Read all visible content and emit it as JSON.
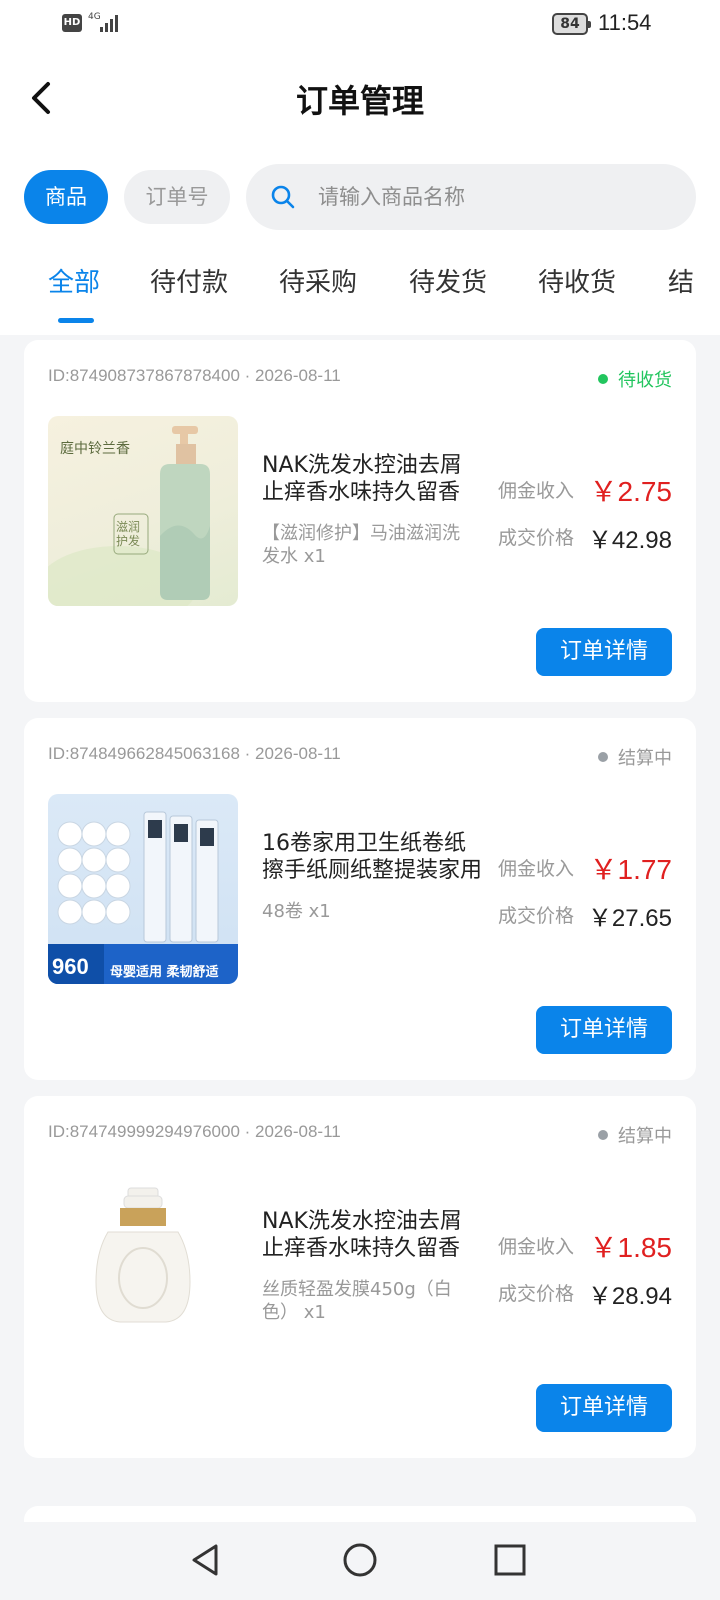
{
  "status_bar": {
    "hd": "HD",
    "network": "4G",
    "battery": "84",
    "time": "11:54"
  },
  "header": {
    "title": "订单管理"
  },
  "search": {
    "segment_product": "商品",
    "segment_order_no": "订单号",
    "placeholder": "请输入商品名称"
  },
  "tabs": [
    "全部",
    "待付款",
    "待采购",
    "待发货",
    "待收货",
    "结"
  ],
  "labels": {
    "commission": "佣金收入",
    "deal_price": "成交价格",
    "detail_button": "订单详情"
  },
  "colors": {
    "accent": "#0a84ea",
    "price_red": "#e02020",
    "status_green": "#22c55e",
    "status_grey": "#9aa0a6"
  },
  "orders": [
    {
      "id_date": "ID:874908737867878400 · 2026-08-11",
      "status": "待收货",
      "status_color": "#22c55e",
      "title": "NAK洗发水控油去屑止痒香水味持久留香",
      "sku": "【滋润修护】马油滋润洗发水 x1",
      "commission": "￥2.75",
      "deal_price": "￥42.98",
      "image_text": "庭中铃兰香",
      "image_sub": "滋润护发"
    },
    {
      "id_date": "ID:874849662845063168 · 2026-08-11",
      "status": "结算中",
      "status_color": "#9aa0a6",
      "title": "16卷家用卫生纸卷纸擦手纸厕纸整提装家用",
      "sku": "48卷 x1",
      "commission": "￥1.77",
      "deal_price": "￥27.65",
      "image_text": "960",
      "image_sub": "母婴适用 柔韧舒适"
    },
    {
      "id_date": "ID:874749999294976000 · 2026-08-11",
      "status": "结算中",
      "status_color": "#9aa0a6",
      "title": "NAK洗发水控油去屑止痒香水味持久留香",
      "sku": "丝质轻盈发膜450g（白色） x1",
      "commission": "￥1.85",
      "deal_price": "￥28.94",
      "image_text": "",
      "image_sub": ""
    }
  ]
}
